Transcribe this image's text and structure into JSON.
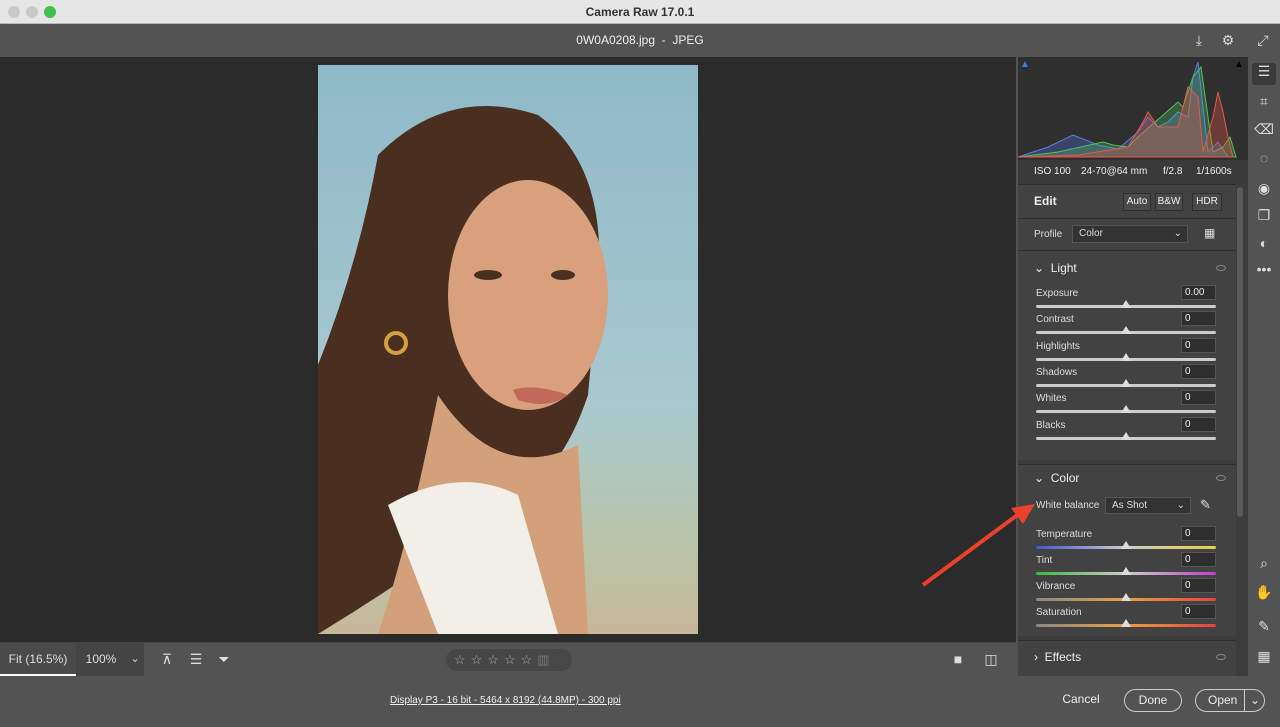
{
  "window": {
    "title": "Camera Raw 17.0.1"
  },
  "header": {
    "filename": "0W0A0208.jpg  -  JPEG"
  },
  "histogram": {
    "iso": "ISO 100",
    "lens": "24-70@64 mm",
    "aperture": "f/2.8",
    "shutter": "1/1600s"
  },
  "edit": {
    "title": "Edit",
    "auto": "Auto",
    "bw": "B&W",
    "hdr": "HDR",
    "profile_label": "Profile",
    "profile_value": "Color"
  },
  "light": {
    "title": "Light",
    "sliders": [
      {
        "label": "Exposure",
        "value": "0.00",
        "pos": 0.5
      },
      {
        "label": "Contrast",
        "value": "0",
        "pos": 0.5
      },
      {
        "label": "Highlights",
        "value": "0",
        "pos": 0.5
      },
      {
        "label": "Shadows",
        "value": "0",
        "pos": 0.5
      },
      {
        "label": "Whites",
        "value": "0",
        "pos": 0.5
      },
      {
        "label": "Blacks",
        "value": "0",
        "pos": 0.5
      }
    ]
  },
  "color": {
    "title": "Color",
    "wb_label": "White balance",
    "wb_value": "As Shot",
    "sliders": [
      {
        "label": "Temperature",
        "value": "0",
        "pos": 0.5
      },
      {
        "label": "Tint",
        "value": "0",
        "pos": 0.5
      },
      {
        "label": "Vibrance",
        "value": "0",
        "pos": 0.5
      },
      {
        "label": "Saturation",
        "value": "0",
        "pos": 0.5
      }
    ]
  },
  "effects": {
    "title": "Effects"
  },
  "bottom": {
    "fit": "Fit (16.5%)",
    "zoom": "100%",
    "rating": 0
  },
  "status": {
    "info": "Display P3 - 16 bit - 5464 x 8192 (44.8MP) - 300 ppi"
  },
  "footer": {
    "cancel": "Cancel",
    "done": "Done",
    "open": "Open"
  },
  "annotation": {
    "arrow_color": "#e8412c"
  }
}
